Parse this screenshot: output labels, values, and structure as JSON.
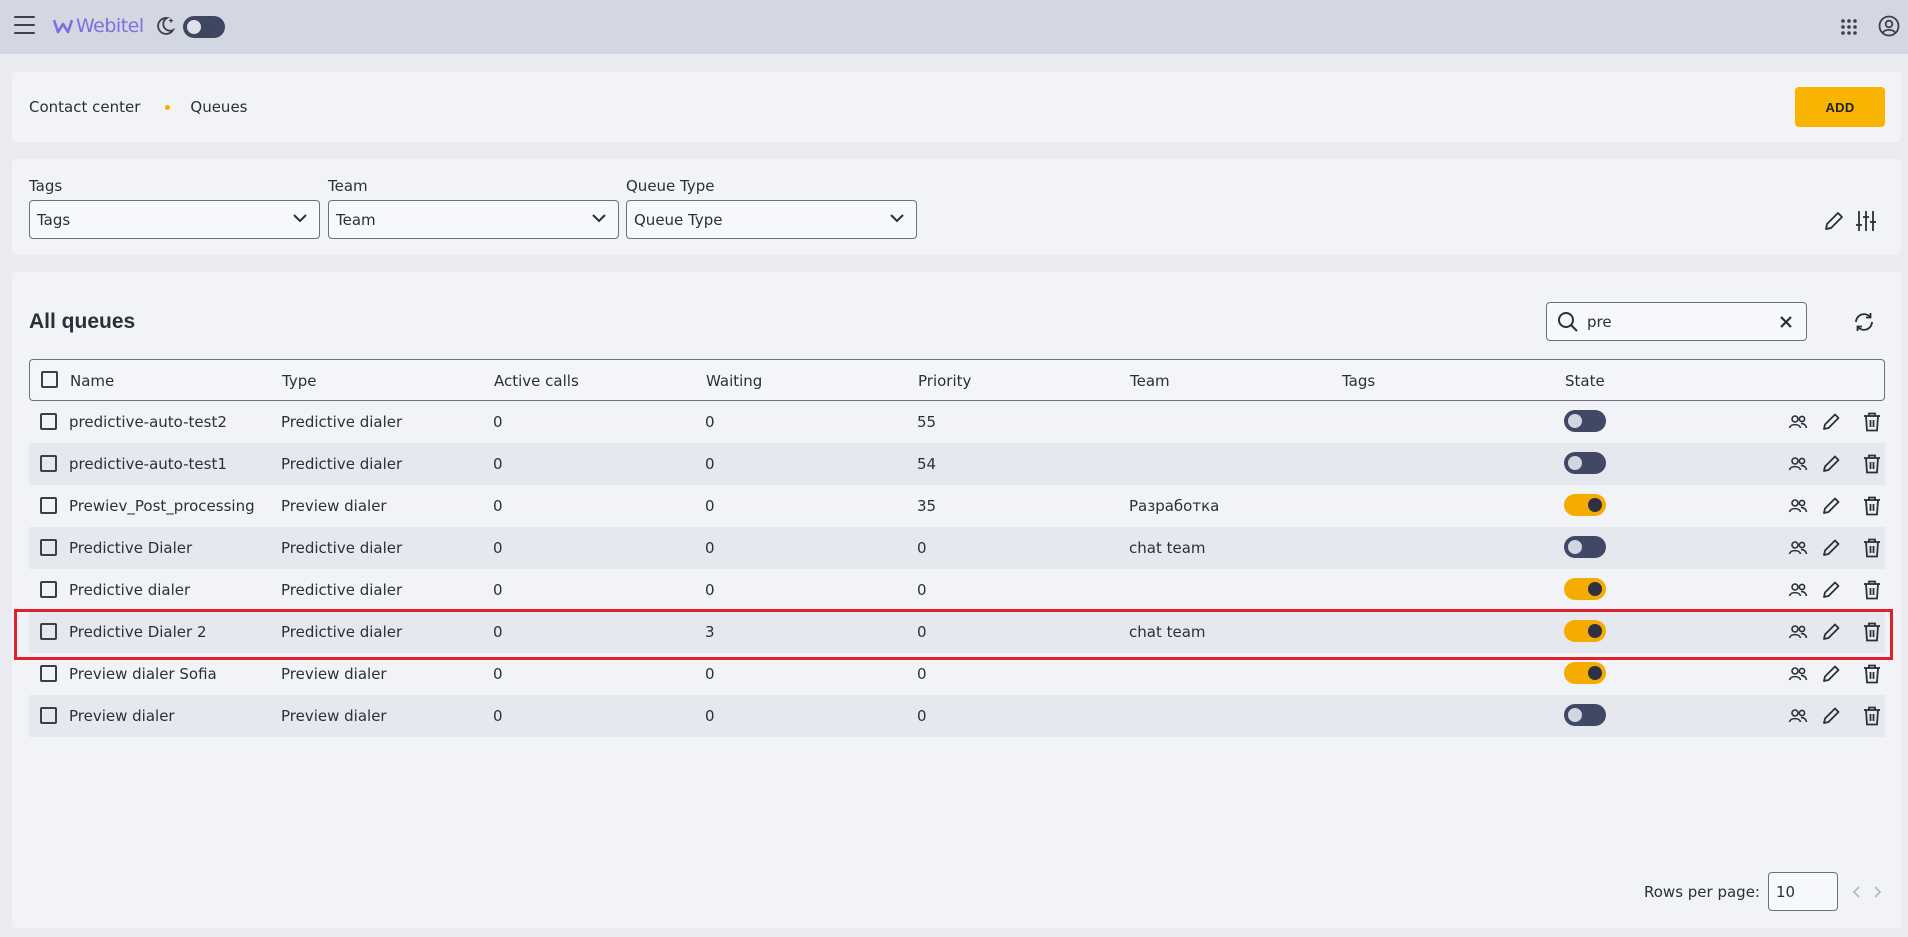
{
  "topbar": {
    "logo_text": "Webitel"
  },
  "breadcrumb": {
    "parent": "Contact center",
    "current": "Queues"
  },
  "add_label": "ADD",
  "filters": [
    {
      "label": "Tags",
      "placeholder": "Tags"
    },
    {
      "label": "Team",
      "placeholder": "Team"
    },
    {
      "label": "Queue Type",
      "placeholder": "Queue Type"
    }
  ],
  "table": {
    "title": "All queues",
    "search_value": "pre",
    "columns": [
      "Name",
      "Type",
      "Active calls",
      "Waiting",
      "Priority",
      "Team",
      "Tags",
      "State"
    ],
    "rows": [
      {
        "name": "predictive-auto-test2",
        "type": "Predictive dialer",
        "active": "0",
        "waiting": "0",
        "priority": "55",
        "team": "",
        "tags": "",
        "state": false
      },
      {
        "name": "predictive-auto-test1",
        "type": "Predictive dialer",
        "active": "0",
        "waiting": "0",
        "priority": "54",
        "team": "",
        "tags": "",
        "state": false
      },
      {
        "name": "Prewiev_Post_processing",
        "type": "Preview dialer",
        "active": "0",
        "waiting": "0",
        "priority": "35",
        "team": "Разработка",
        "tags": "",
        "state": true
      },
      {
        "name": "Predictive Dialer",
        "type": "Predictive dialer",
        "active": "0",
        "waiting": "0",
        "priority": "0",
        "team": "chat team",
        "tags": "",
        "state": false
      },
      {
        "name": "Predictive dialer",
        "type": "Predictive dialer",
        "active": "0",
        "waiting": "0",
        "priority": "0",
        "team": "",
        "tags": "",
        "state": true
      },
      {
        "name": "Predictive Dialer 2",
        "type": "Predictive dialer",
        "active": "0",
        "waiting": "3",
        "priority": "0",
        "team": "chat team",
        "tags": "",
        "state": true
      },
      {
        "name": "Preview dialer Sofia",
        "type": "Preview dialer",
        "active": "0",
        "waiting": "0",
        "priority": "0",
        "team": "",
        "tags": "",
        "state": true
      },
      {
        "name": "Preview dialer",
        "type": "Preview dialer",
        "active": "0",
        "waiting": "0",
        "priority": "0",
        "team": "",
        "tags": "",
        "state": false
      }
    ]
  },
  "pagination": {
    "rows_per_page_label": "Rows per page:",
    "rows_per_page": "10"
  },
  "colors": {
    "accent": "#f9b301",
    "toggle_off": "#404866",
    "highlight": "#e0202b"
  }
}
